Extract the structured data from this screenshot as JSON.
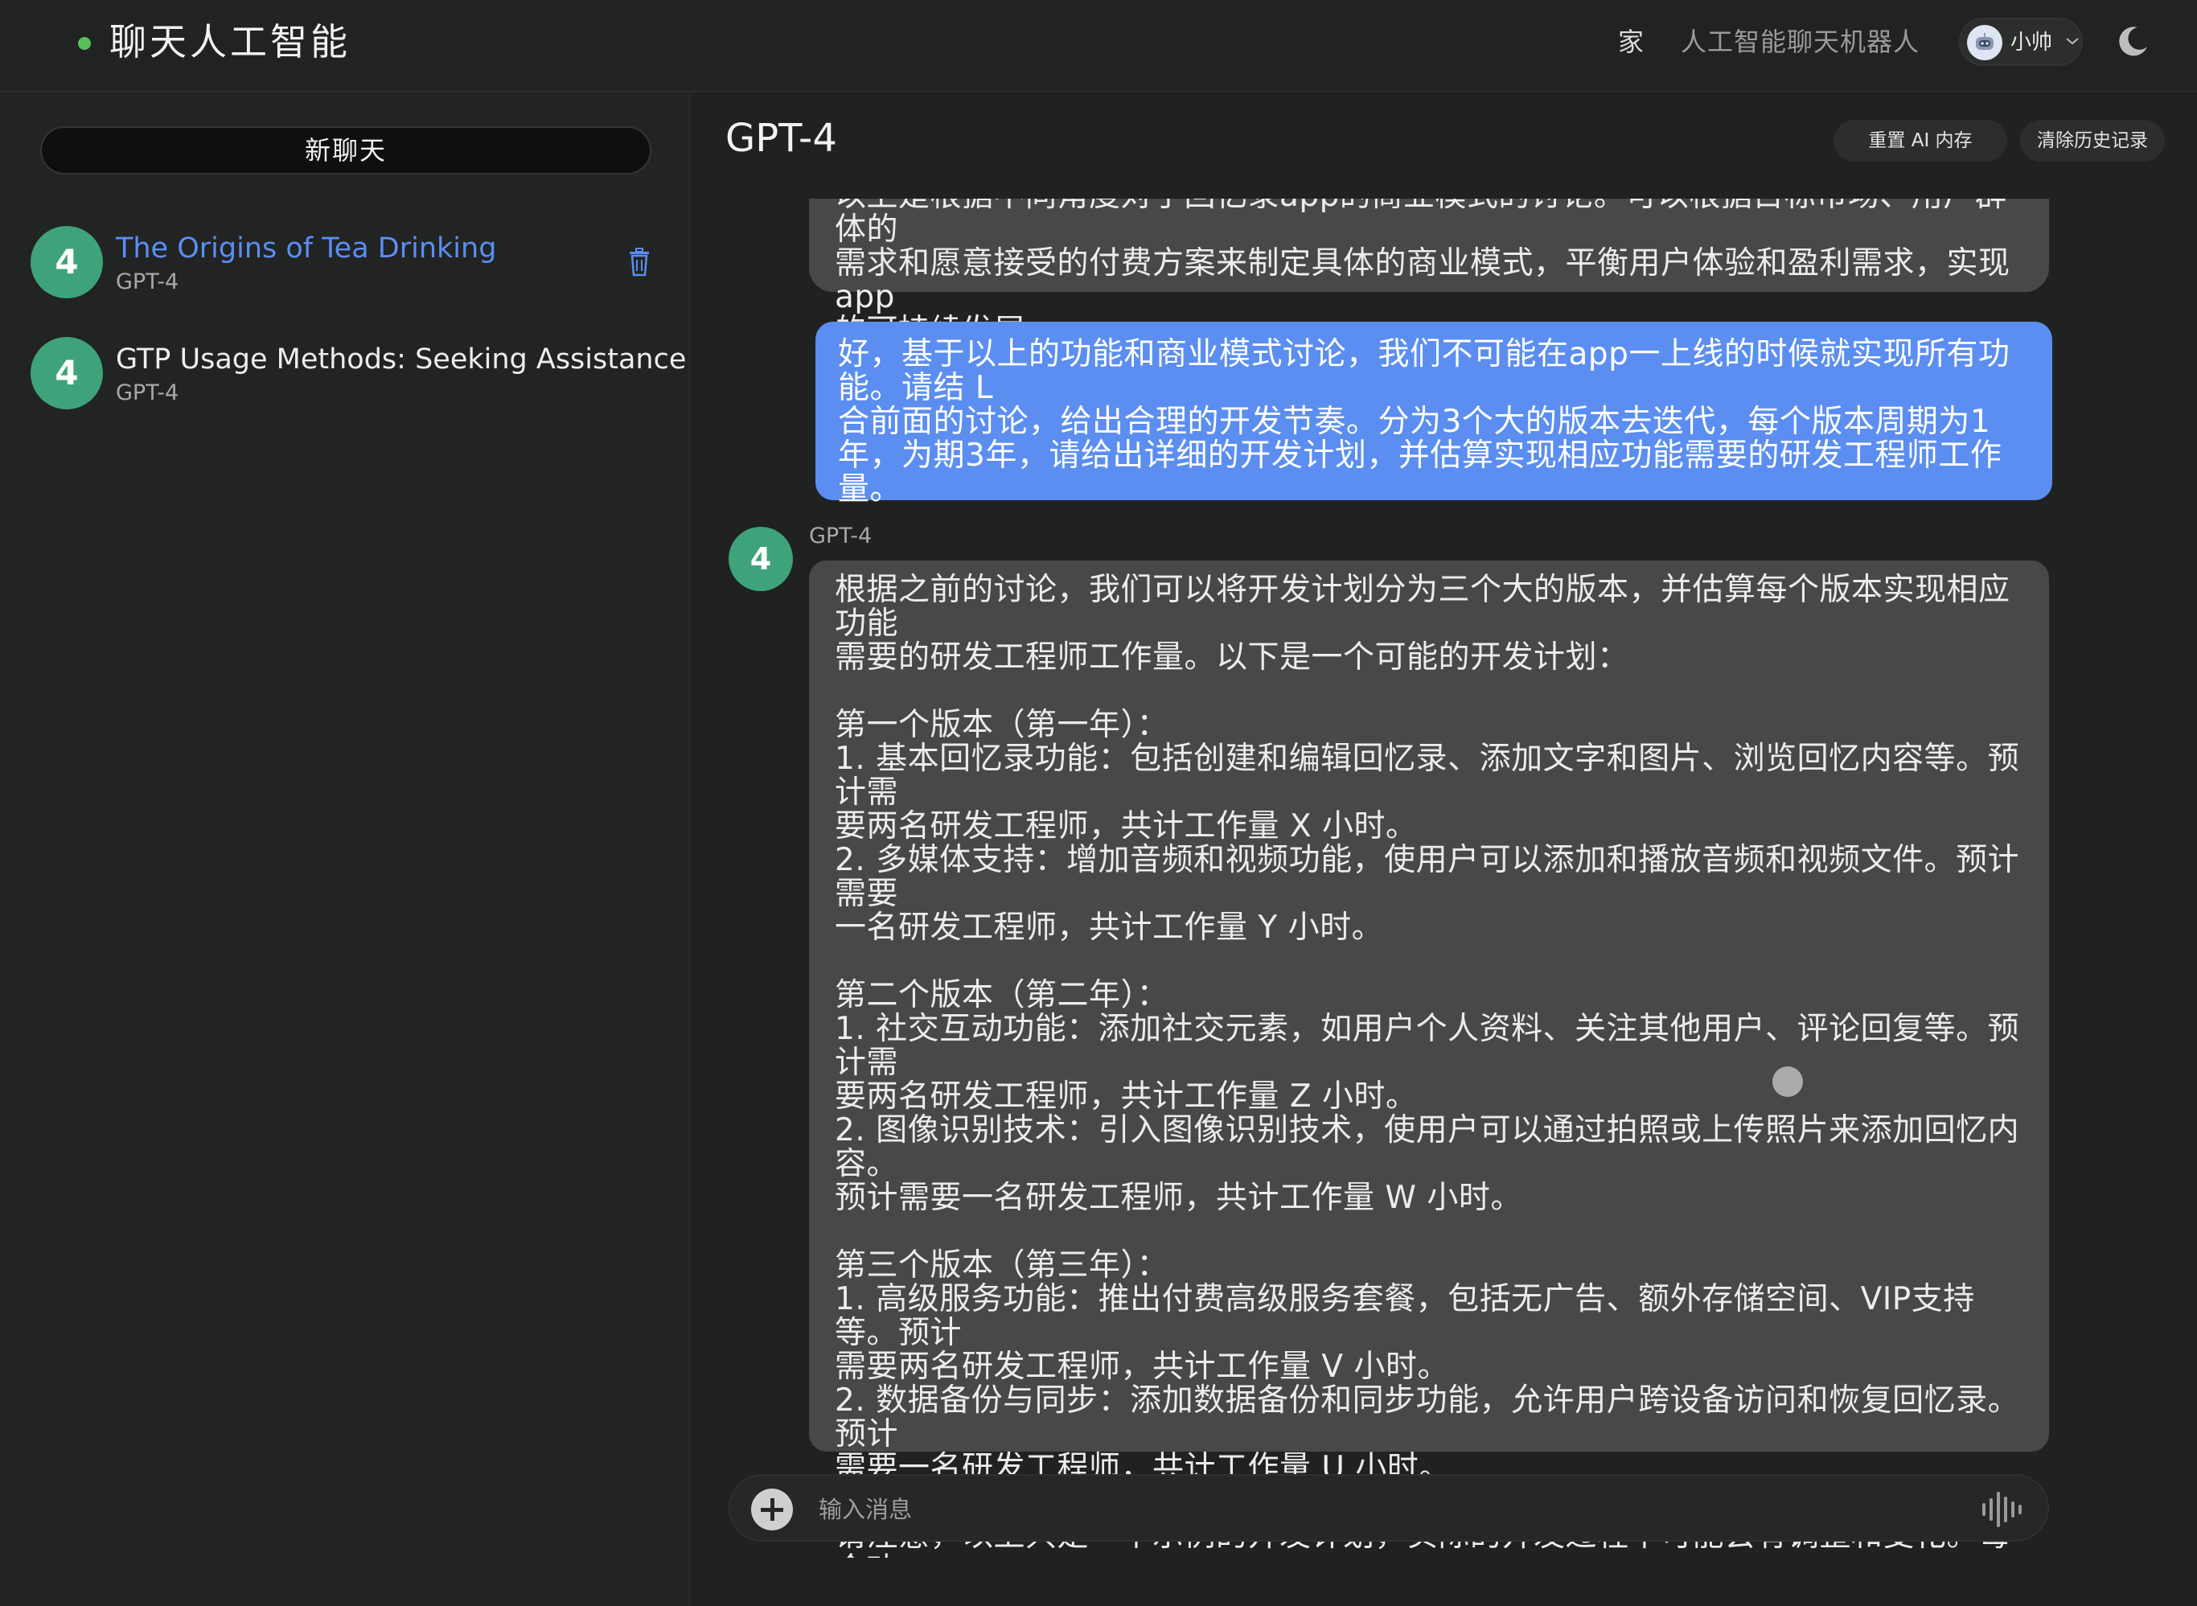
{
  "header": {
    "brand_title": "聊天人工智能",
    "nav_home": "家",
    "nav_chatbot": "人工智能聊天机器人",
    "user_name": "小帅"
  },
  "sidebar": {
    "new_chat_label": "新聊天",
    "items": [
      {
        "badge": "4",
        "title": "The Origins of Tea Drinking",
        "model": "GPT-4",
        "active": true
      },
      {
        "badge": "4",
        "title": "GTP Usage Methods: Seeking Assistance",
        "model": "GPT-4",
        "active": false
      }
    ]
  },
  "main": {
    "model_title": "GPT-4",
    "reset_memory_label": "重置 AI 内存",
    "clear_history_label": "清除历史记录",
    "messages": {
      "prev_ai_tail": "以上是根据不同角度对于回忆录app的商业模式的讨论。可以根据目标市场、用户群体的\n需求和愿意接受的付费方案来制定具体的商业模式，平衡用户体验和盈利需求，实现app\n的可持续发展。",
      "user": "好，基于以上的功能和商业模式讨论，我们不可能在app一上线的时候就实现所有功能。请结 L\n合前面的讨论，给出合理的开发节奏。分为3个大的版本去迭代，每个版本周期为1年，为期3年，请给出详细的开发计划，并估算实现相应功能需要的研发工程师工作量。",
      "ai_badge": "4",
      "ai_name": "GPT-4",
      "ai": "根据之前的讨论，我们可以将开发计划分为三个大的版本，并估算每个版本实现相应功能\n需要的研发工程师工作量。以下是一个可能的开发计划：\n\n第一个版本（第一年）：\n1. 基本回忆录功能：包括创建和编辑回忆录、添加文字和图片、浏览回忆内容等。预计需\n要两名研发工程师，共计工作量 X 小时。\n2. 多媒体支持：增加音频和视频功能，使用户可以添加和播放音频和视频文件。预计需要\n一名研发工程师，共计工作量 Y 小时。\n\n第二个版本（第二年）：\n1. 社交互动功能：添加社交元素，如用户个人资料、关注其他用户、评论回复等。预计需\n要两名研发工程师，共计工作量 Z 小时。\n2. 图像识别技术：引入图像识别技术，使用户可以通过拍照或上传照片来添加回忆内容。\n预计需要一名研发工程师，共计工作量 W 小时。\n\n第三个版本（第三年）：\n1. 高级服务功能：推出付费高级服务套餐，包括无广告、额外存储空间、VIP支持等。预计\n需要两名研发工程师，共计工作量 V 小时。\n2. 数据备份与同步：添加数据备份和同步功能，允许用户跨设备访问和恢复回忆录。预计\n需要一名研发工程师，共计工作量 U 小时。\n\n请注意，以上只是一个示例的开发计划，实际的开发过程中可能会有调整和变化。每个功\n能的工作量估算要基于具体的需求和技术实现复杂度来确定。另外，还需要考虑测试、设\n计、项目管理等其他人力资源和工作量。这些需要根据团队的实际情况进行进一步的规划\n和安排。"
    },
    "composer": {
      "placeholder": "输入消息",
      "value": ""
    }
  },
  "icons": {
    "status_dot": "online-dot-icon",
    "avatar": "robot-avatar-icon",
    "chevron": "chevron-down-icon",
    "theme": "moon-icon",
    "delete": "trash-icon",
    "attach": "plus-icon",
    "voice": "voice-wave-icon"
  },
  "colors": {
    "accent": "#5b8ef0",
    "badge": "#3ea37a",
    "online": "#57c25a",
    "bubble": "#474848",
    "background": "#202121"
  }
}
